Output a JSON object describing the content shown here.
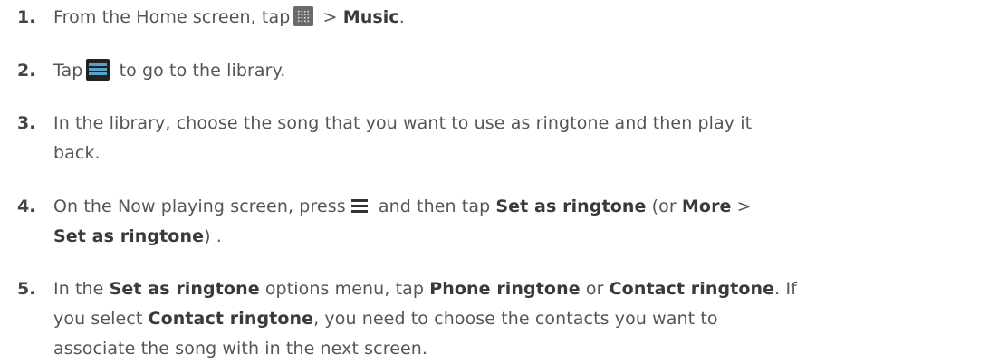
{
  "steps": [
    {
      "number": "1.",
      "part1": "From the Home screen, tap",
      "icon": "all-apps-grid-icon",
      "part2": " > ",
      "music": "Music",
      "part3": "."
    },
    {
      "number": "2.",
      "part1": "Tap",
      "icon": "library-menu-icon",
      "part2": " to go to the library."
    },
    {
      "number": "3.",
      "line1": "In the library, choose the song that you want to use as ringtone and then play it",
      "line2": "back."
    },
    {
      "number": "4.",
      "part1": "On the Now playing screen, press",
      "icon": "menu-key-icon",
      "part2": " and then tap ",
      "set_ringtone": "Set as ringtone",
      "part3": " (or ",
      "more": "More",
      "part4": " >",
      "line2_hl": "Set as ringtone",
      "line2_end": ") ."
    },
    {
      "number": "5.",
      "part1": "In the ",
      "set_ringtone": "Set as ringtone",
      "part2": " options menu, tap ",
      "phone_ringtone": "Phone ringtone",
      "part3": " or ",
      "contact_ringtone": "Contact ringtone",
      "part4": ". If",
      "line2_start": "you select ",
      "line2_hl": "Contact ringtone",
      "line2_rest": ", you need to choose the contacts you want to",
      "line3": "associate the song with in the next screen."
    }
  ],
  "colors": {
    "text": "#555555",
    "highlight": "#3a3a3a",
    "icon_dark": "#222222",
    "icon_accent": "#5aa0c8"
  }
}
